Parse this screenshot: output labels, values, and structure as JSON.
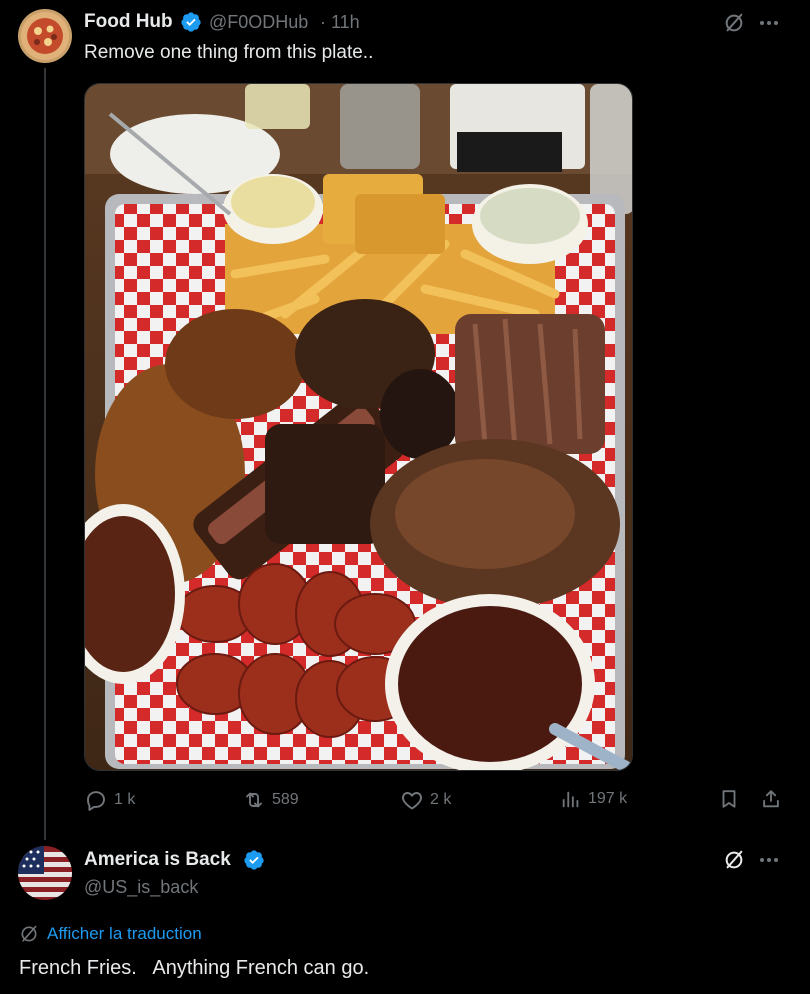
{
  "tweet": {
    "author": "Food Hub",
    "handle": "@F0ODHub",
    "time": "· 11h",
    "text": "Remove one thing from this plate..",
    "image_alt": "BBQ platter with ribs, brisket, pulled pork, chicken, sausage, fries, cornbread and sauces",
    "stats": {
      "replies": "1 k",
      "reposts": "589",
      "likes": "2 k",
      "views": "197 k"
    }
  },
  "reply": {
    "author": "America is Back",
    "handle": "@US_is_back",
    "translate_label": "Afficher la traduction",
    "text": "French Fries.   Anything French can go."
  },
  "colors": {
    "accent": "#1d9bf0",
    "muted": "#71767b",
    "text": "#e7e9ea",
    "background": "#000000"
  }
}
